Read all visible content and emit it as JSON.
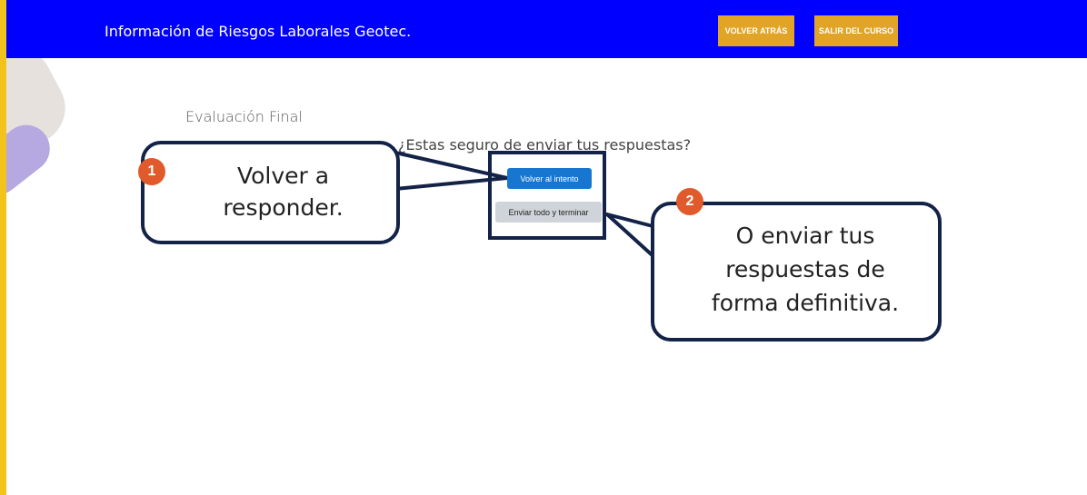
{
  "header": {
    "site_title": "Información de Riesgos Laborales Geotec.",
    "back_button": "VOLVER ATRÁS",
    "exit_button": "SALIR DEL CURSO"
  },
  "page": {
    "title": "Evaluación Final",
    "confirm_question": "¿Estas seguro de enviar tus respuestas?",
    "return_button": "Volver al intento",
    "submit_button": "Enviar todo y terminar"
  },
  "callouts": [
    {
      "number": "1",
      "text_lines": [
        "Volver a",
        "responder."
      ]
    },
    {
      "number": "2",
      "text_lines": [
        "O enviar tus",
        "respuestas de",
        "forma definitiva."
      ]
    }
  ],
  "colors": {
    "topbar": "#0000ff",
    "accent_button": "#e2a426",
    "badge": "#e05a2b",
    "outline": "#132247",
    "primary_button": "#1777d0",
    "frame_border": "#f2c41b"
  }
}
